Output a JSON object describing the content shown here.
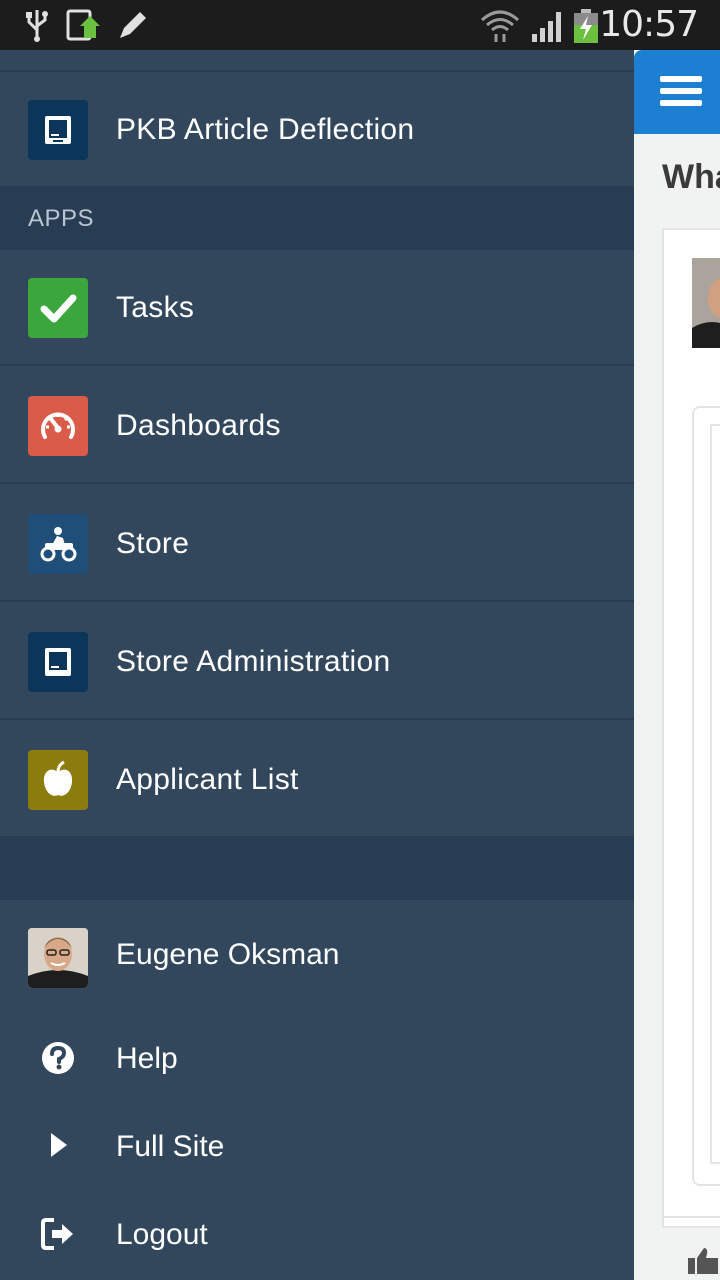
{
  "status_bar": {
    "time": "10:57",
    "icons": [
      "usb-icon",
      "screenshot-icon",
      "pencil-icon",
      "wifi-icon",
      "signal-icon",
      "battery-charging-icon"
    ]
  },
  "drawer": {
    "top_items": [
      {
        "label": "PKB Article Deflection",
        "icon": "tablet-icon",
        "icon_bg": "#0b3559"
      }
    ],
    "apps_header": "APPS",
    "apps": [
      {
        "label": "Tasks",
        "icon": "checkmark-icon",
        "icon_bg": "#3aa63c"
      },
      {
        "label": "Dashboards",
        "icon": "speedometer-icon",
        "icon_bg": "#d95c4a"
      },
      {
        "label": "Store",
        "icon": "atv-icon",
        "icon_bg": "#1f4e78"
      },
      {
        "label": "Store Administration",
        "icon": "tablet-icon",
        "icon_bg": "#0b3559"
      },
      {
        "label": "Applicant List",
        "icon": "apple-icon",
        "icon_bg": "#8b7d0d"
      }
    ],
    "footer": {
      "user_name": "Eugene Oksman",
      "help": "Help",
      "full_site": "Full Site",
      "logout": "Logout"
    }
  },
  "content": {
    "title_partial": "Wha",
    "accent": "#1d7fd2"
  }
}
